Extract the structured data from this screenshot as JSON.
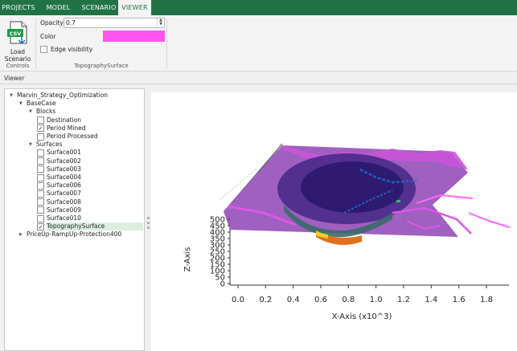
{
  "tabs": [
    {
      "label": "PROJECTS",
      "active": false
    },
    {
      "label": "MODEL",
      "active": false
    },
    {
      "label": "SCENARIO",
      "active": false
    },
    {
      "label": "VIEWER",
      "active": true
    }
  ],
  "ribbon": {
    "load_label_1": "Load",
    "load_label_2": "Scenario",
    "load_icon": "csv-file-icon",
    "controls_group_label": "Controls",
    "opacity_label": "Opacity",
    "opacity_value": "0.7",
    "color_label": "Color",
    "color_value": "#ff55ee",
    "edge_visibility_label": "Edge visibility",
    "edge_visibility_checked": false,
    "topography_group_label": "TopographySurface"
  },
  "viewer_label": "Viewer",
  "tree": {
    "root": "Marvin_Strategy_Optimization",
    "base_case": "BaseCase",
    "blocks_folder": "Blocks",
    "blocks": [
      {
        "label": "Destination",
        "checked": false
      },
      {
        "label": "Period Mined",
        "checked": true
      },
      {
        "label": "Period Processed",
        "checked": false
      }
    ],
    "surfaces_folder": "Surfaces",
    "surfaces": [
      {
        "label": "Surface001",
        "checked": false
      },
      {
        "label": "Surface002",
        "checked": false
      },
      {
        "label": "Surface003",
        "checked": false
      },
      {
        "label": "Surface004",
        "checked": false
      },
      {
        "label": "Surface006",
        "checked": false
      },
      {
        "label": "Surface007",
        "checked": false
      },
      {
        "label": "Surface008",
        "checked": false
      },
      {
        "label": "Surface009",
        "checked": false
      },
      {
        "label": "Surface010",
        "checked": false
      },
      {
        "label": "TopographySurface",
        "checked": true,
        "selected": true
      }
    ],
    "second_scenario": "PriceUp-RampUp-Protection400"
  },
  "plot": {
    "x_axis_label": "X-Axis (x10^3)",
    "x_ticks": [
      "0.0",
      "0.2",
      "0.4",
      "0.6",
      "0.8",
      "1.0",
      "1.2",
      "1.4",
      "1.6",
      "1.8"
    ],
    "z_axis_label": "Z-Axis",
    "z_ticks": [
      "0",
      "50",
      "100",
      "150",
      "200",
      "250",
      "300",
      "350",
      "400",
      "450",
      "500"
    ],
    "surface_color": "#8e44b4",
    "surface_edge_color": "#e055e8"
  }
}
